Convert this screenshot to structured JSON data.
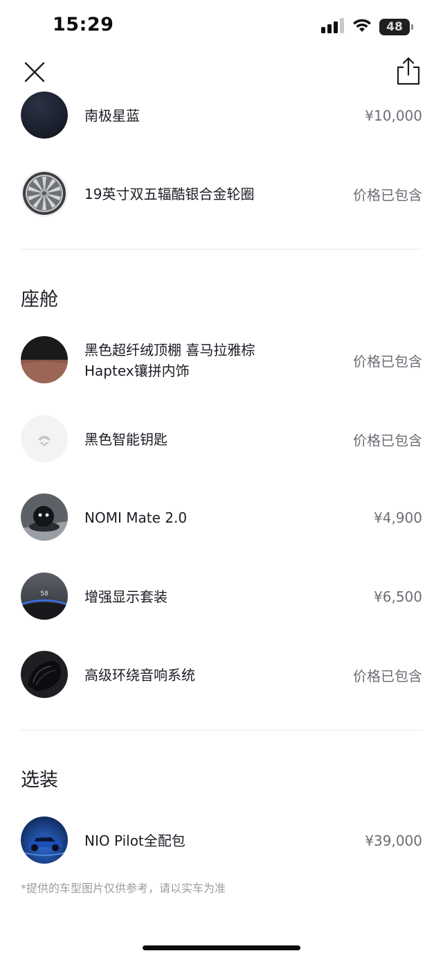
{
  "status_bar": {
    "time": "15:29",
    "battery": "48"
  },
  "icons": {
    "close": "close-icon",
    "share": "share-icon",
    "signal": "cellular-signal-icon",
    "wifi": "wifi-icon",
    "battery": "battery-icon"
  },
  "exterior": {
    "items": [
      {
        "name": "南极星蓝",
        "price": "¥10,000",
        "thumb": "paint-swatch-blue"
      },
      {
        "name": "19英寸双五辐酷银合金轮圈",
        "price": "价格已包含",
        "thumb": "alloy-wheel"
      }
    ]
  },
  "cabin": {
    "title": "座舱",
    "items": [
      {
        "name_line1": "黑色超纤绒顶棚 喜马拉雅棕",
        "name_line2": "Haptex镶拼内饰",
        "price": "价格已包含",
        "thumb": "interior-swatch"
      },
      {
        "name": "黑色智能钥匙",
        "price": "价格已包含",
        "thumb": "nio-key-logo"
      },
      {
        "name": "NOMI Mate 2.0",
        "price": "¥4,900",
        "thumb": "nomi-robot"
      },
      {
        "name": "增强显示套装",
        "price": "¥6,500",
        "thumb": "hud-display"
      },
      {
        "name": "高级环绕音响系统",
        "price": "价格已包含",
        "thumb": "speaker"
      }
    ]
  },
  "options": {
    "title": "选装",
    "items": [
      {
        "name": "NIO Pilot全配包",
        "price": "¥39,000",
        "thumb": "car-render"
      }
    ]
  },
  "footnote": "*提供的车型图片仅供参考，请以实车为准",
  "colors": {
    "text_primary": "#1b1d24",
    "text_secondary": "#6b6e75",
    "footnote": "#9a9ca2",
    "divider": "#e8e8ea",
    "paint_blue": "#1c2230"
  }
}
